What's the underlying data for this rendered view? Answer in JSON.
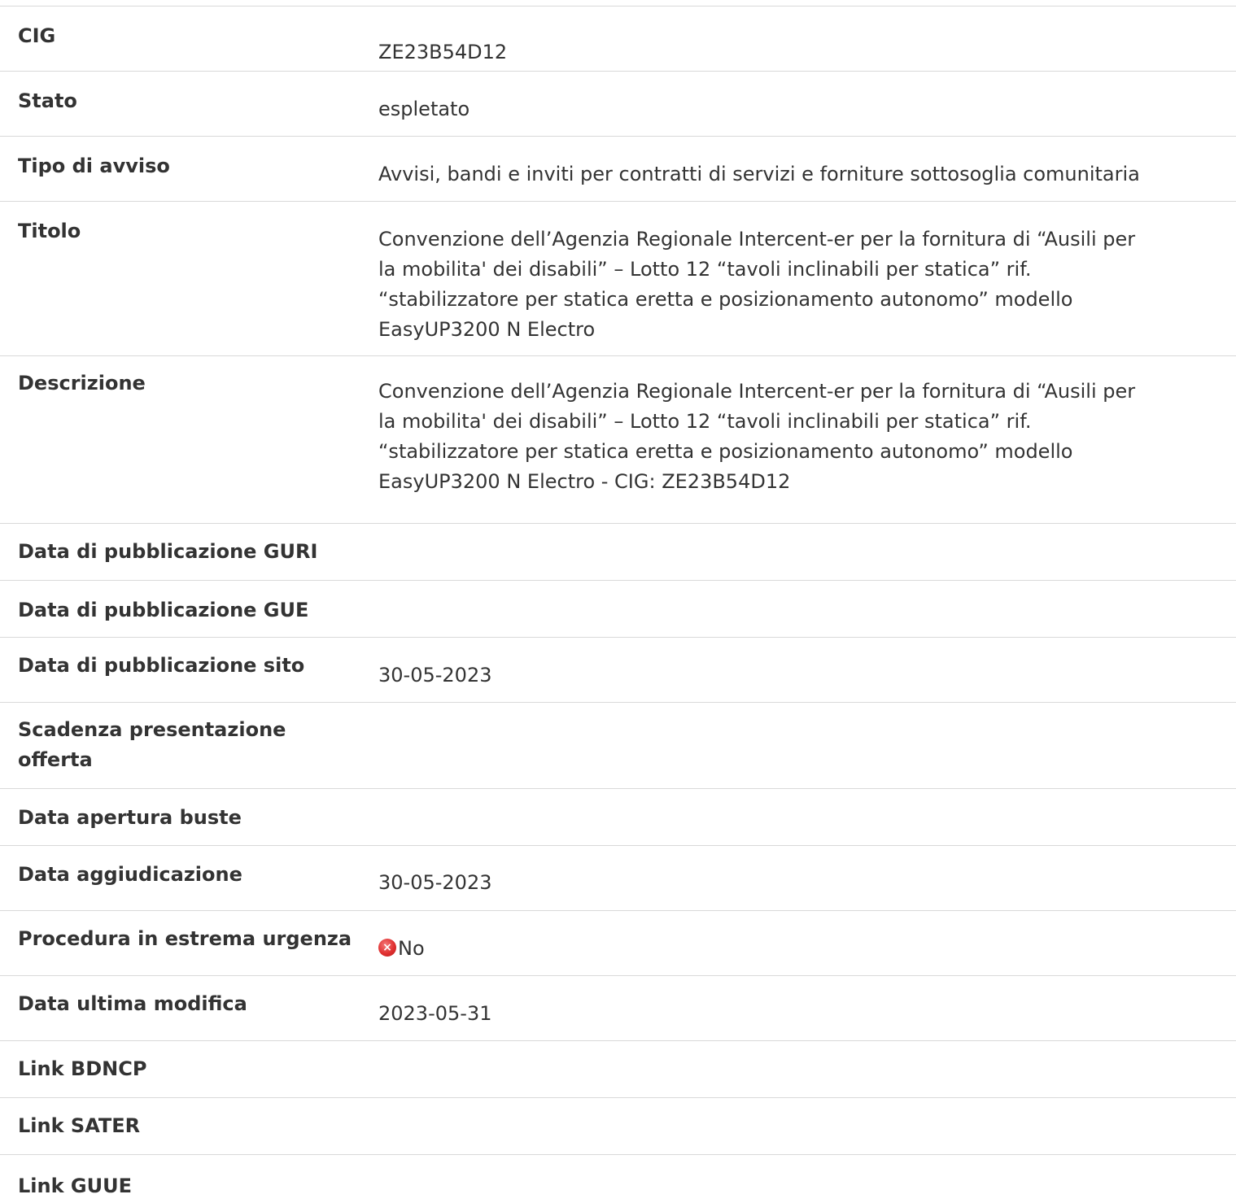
{
  "rows": [
    {
      "label": "CIG",
      "value": "ZE23B54D12"
    },
    {
      "label": "Stato",
      "value": "espletato"
    },
    {
      "label": "Tipo di avviso",
      "value": "Avvisi, bandi e inviti per contratti di servizi e forniture sottosoglia comunitaria"
    },
    {
      "label": "Titolo",
      "value_lines": [
        "Convenzione dell’Agenzia Regionale Intercent-er per la fornitura di “Ausili per",
        "la mobilita' dei disabili” – Lotto 12 “tavoli inclinabili per statica” rif.",
        "“stabilizzatore per statica eretta e posizionamento autonomo” modello",
        "EasyUP3200 N Electro"
      ]
    },
    {
      "label": "Descrizione",
      "value_lines": [
        "Convenzione dell’Agenzia Regionale Intercent-er per la fornitura di “Ausili per",
        "la mobilita' dei disabili” – Lotto 12 “tavoli inclinabili per statica” rif.",
        "“stabilizzatore per statica eretta e posizionamento autonomo” modello",
        "EasyUP3200 N Electro - CIG: ZE23B54D12"
      ]
    },
    {
      "label": "Data di pubblicazione GURI",
      "value": ""
    },
    {
      "label": "Data di pubblicazione GUE",
      "value": ""
    },
    {
      "label": "Data di pubblicazione sito",
      "value": "30-05-2023"
    },
    {
      "label_lines": [
        "Scadenza presentazione",
        "offerta"
      ],
      "value": ""
    },
    {
      "label": "Data apertura buste",
      "value": ""
    },
    {
      "label": "Data aggiudicazione",
      "value": "30-05-2023"
    },
    {
      "label": "Procedura in estrema urgenza",
      "value": "No",
      "icon": "close-circle-icon",
      "icon_color": "#e03030"
    },
    {
      "label": "Data ultima modifica",
      "value": "2023-05-31"
    },
    {
      "label": "Link BDNCP",
      "value": ""
    },
    {
      "label": "Link SATER",
      "value": ""
    },
    {
      "label": "Link GUUE",
      "value": ""
    }
  ]
}
